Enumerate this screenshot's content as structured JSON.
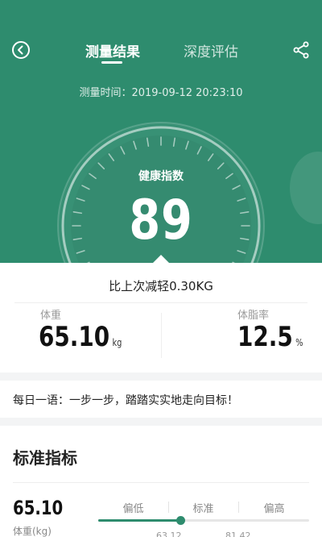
{
  "header": {
    "tabs": [
      {
        "label": "测量结果",
        "active": true
      },
      {
        "label": "深度评估",
        "active": false
      }
    ],
    "back_icon": "back-circle-icon",
    "share_icon": "share-icon"
  },
  "measurement": {
    "time_label": "测量时间：2019-09-12 20:23:10"
  },
  "score": {
    "label": "健康指数",
    "value": "89"
  },
  "summary": {
    "compare_text": "比上次减轻0.30KG",
    "weight": {
      "label": "体重",
      "value": "65.10",
      "unit": "kg"
    },
    "body_fat": {
      "label": "体脂率",
      "value": "12.5",
      "unit": "%"
    }
  },
  "daily_quote": "每日一语：一步一步，踏踏实实地走向目标！",
  "indicators": {
    "title": "标准指标",
    "weight_value": "65.10",
    "weight_label": "体重(kg)",
    "ranges": [
      "偏低",
      "标准",
      "偏高"
    ],
    "ticks": [
      "63.12",
      "81.42"
    ],
    "level_fraction": 0.39
  },
  "colors": {
    "primary": "#2e8c6e",
    "background": "#f3f4f5"
  }
}
